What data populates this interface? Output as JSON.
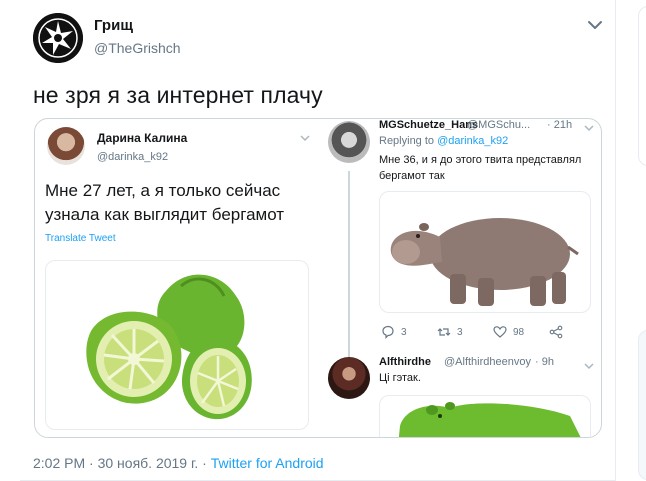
{
  "tweet": {
    "author_name": "Грищ",
    "author_handle": "@TheGrishch",
    "text": "не зря я за интернет плачу",
    "footer": {
      "time": "2:02 PM",
      "separator": " · ",
      "date": "30 нояб. 2019 г.",
      "source": "Twitter for Android"
    }
  },
  "quoted": {
    "name": "Дарина Калина",
    "handle": "@darinka_k92",
    "text": "Мне 27 лет, а я только сейчас узнала как выглядит бергамот",
    "translate": "Translate Tweet",
    "image_icon": "bergamot-fruit-photo"
  },
  "reply1": {
    "name": "MGSchuetze_Hans",
    "handle": "@MGSchu...",
    "time": "· 21h",
    "replying_prefix": "Replying to ",
    "replying_mention": "@darinka_k92",
    "text": "Мне 36, и я до этого твита представлял бергамот так",
    "image_icon": "hippopotamus-photo",
    "actions": {
      "replies": "3",
      "retweets": "3",
      "likes": "98"
    }
  },
  "reply2": {
    "name": "Alfthirdhe",
    "handle": "@Alfthirdheenvoy",
    "time": "· 9h",
    "text": "Ці гэтак.",
    "image_icon": "green-hippopotamus-photo"
  },
  "colors": {
    "link": "#1da1f2",
    "secondary_text": "#657786",
    "border": "#e6ecf0"
  }
}
